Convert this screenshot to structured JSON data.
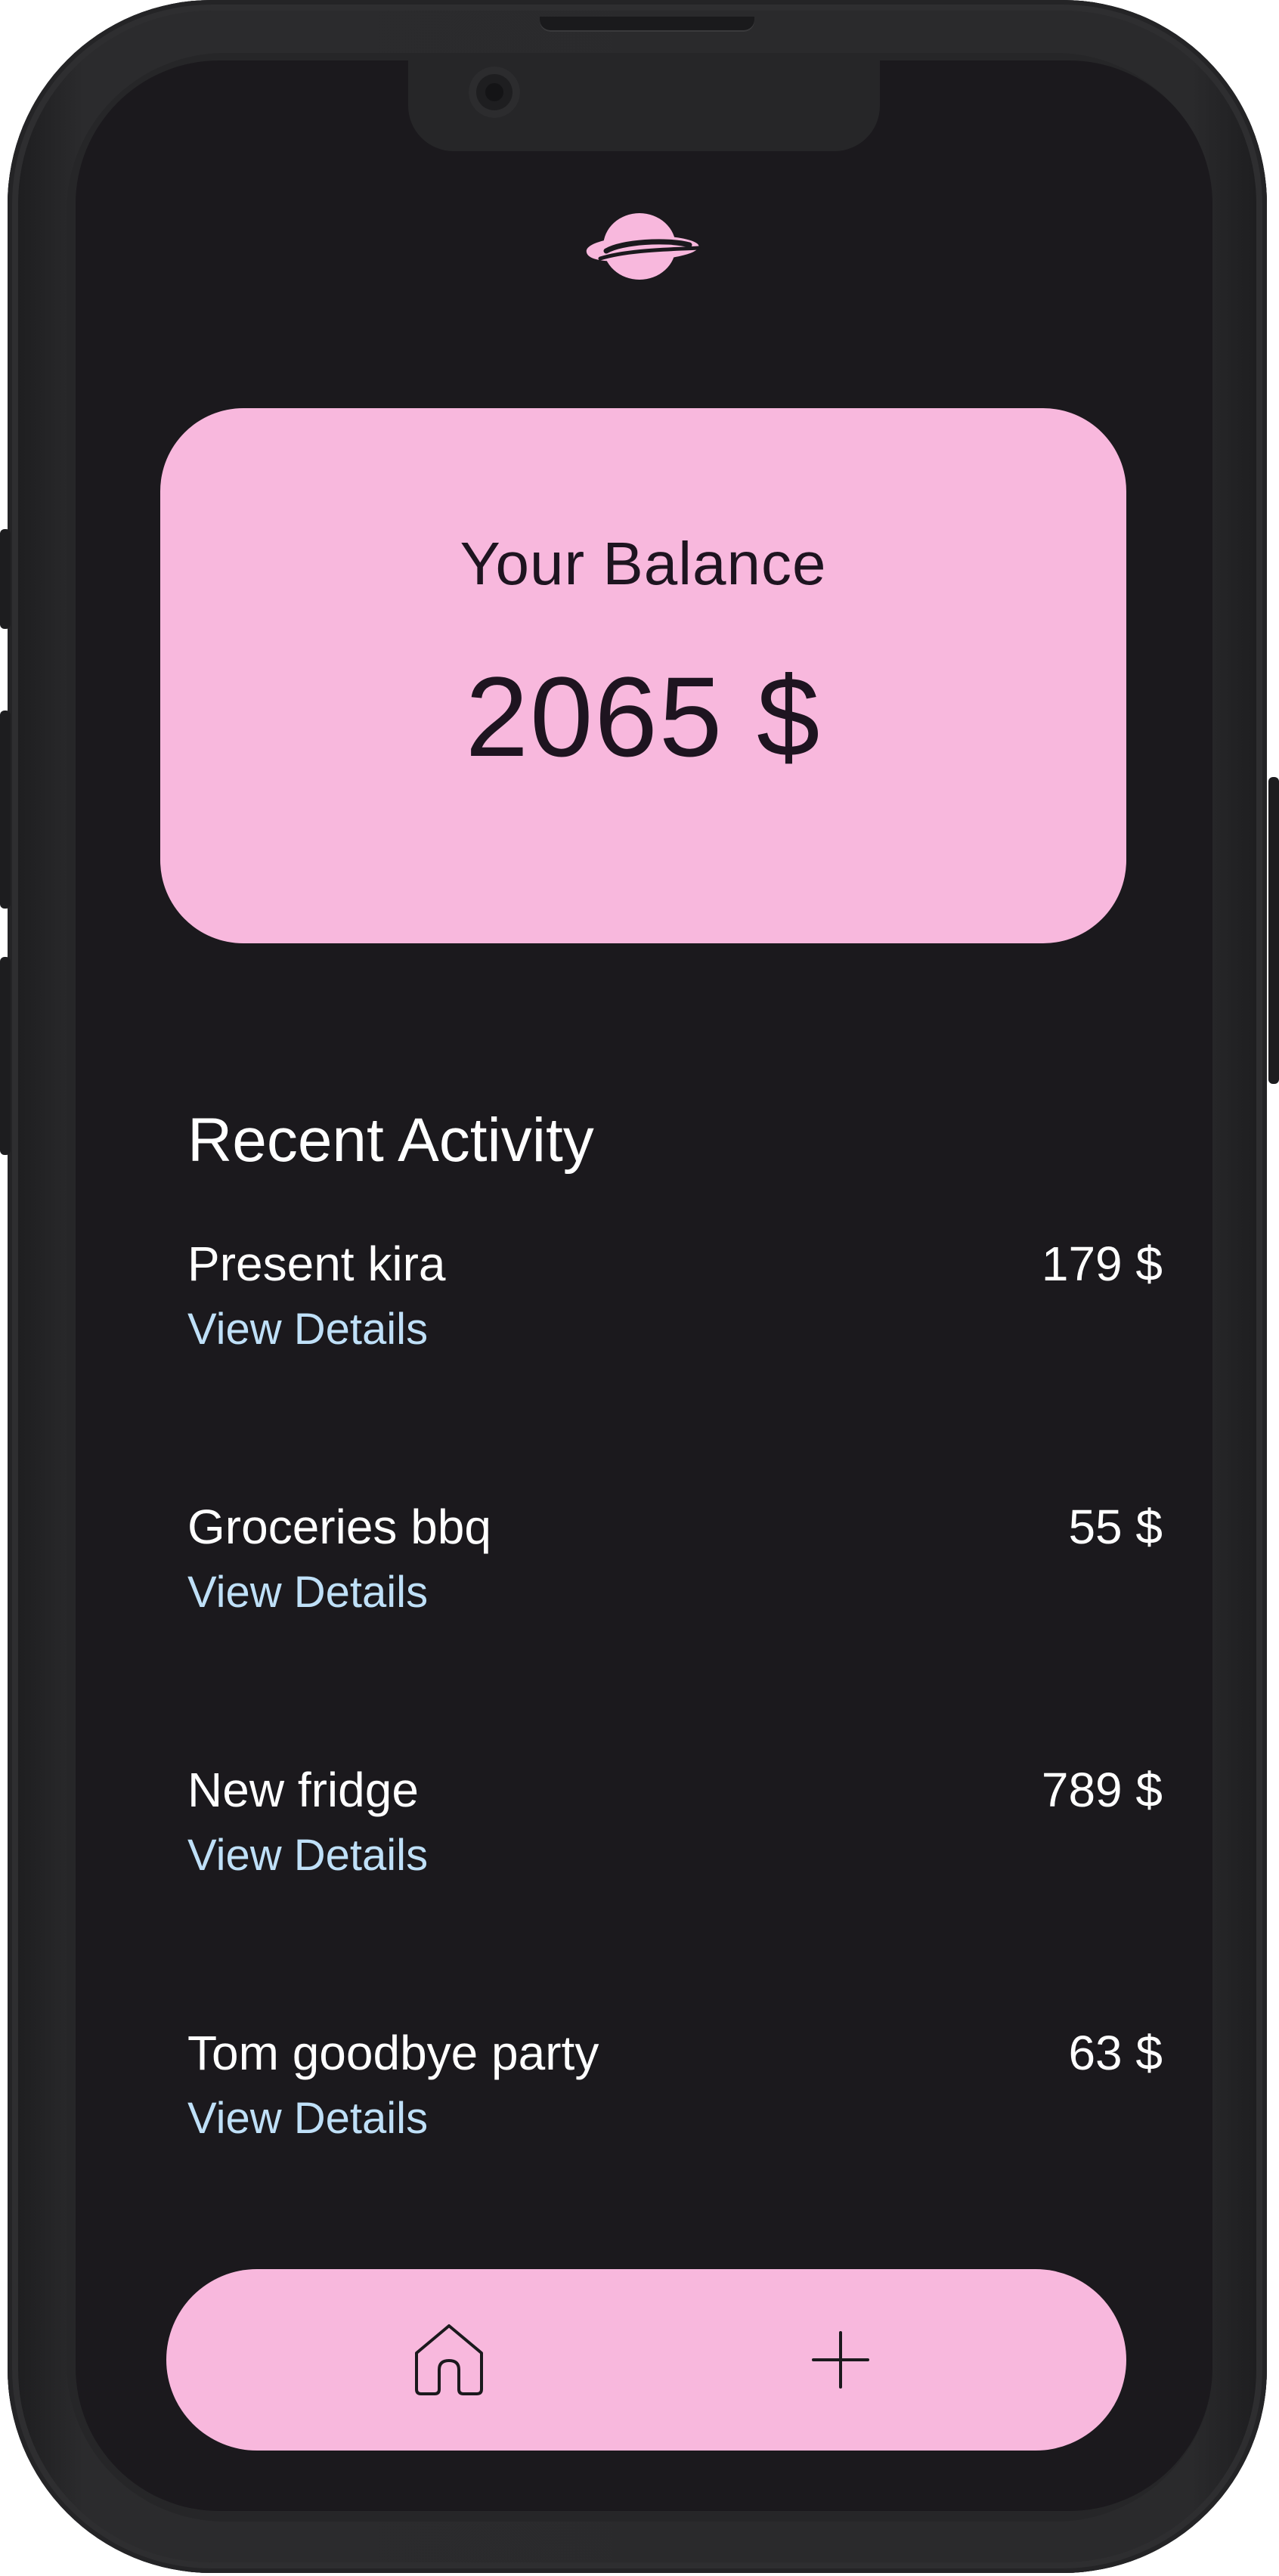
{
  "app": {
    "logo_icon": "planet-icon",
    "accent_color": "#f8b8dd",
    "background_color": "#1b191d",
    "link_color": "#bfe0f8"
  },
  "balance": {
    "label": "Your Balance",
    "value": "2065 $"
  },
  "recent_activity": {
    "title": "Recent Activity",
    "items": [
      {
        "name": "Present kira",
        "amount": "179 $",
        "link_label": "View Details"
      },
      {
        "name": "Groceries bbq",
        "amount": "55 $",
        "link_label": "View Details"
      },
      {
        "name": "New fridge",
        "amount": "789 $",
        "link_label": "View Details"
      },
      {
        "name": "Tom goodbye party",
        "amount": "63 $",
        "link_label": "View Details"
      }
    ]
  },
  "nav": {
    "home_icon": "home-icon",
    "add_icon": "plus-icon"
  }
}
